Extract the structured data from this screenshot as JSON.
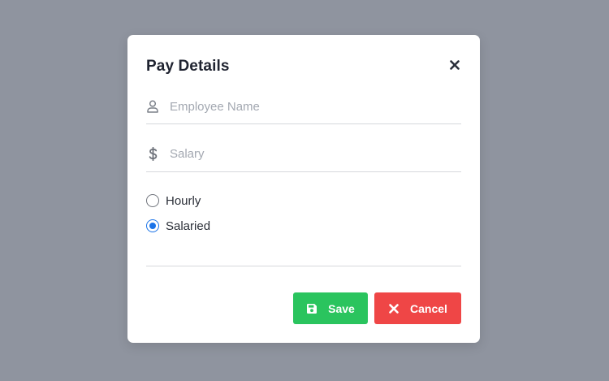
{
  "modal": {
    "title": "Pay Details",
    "close_icon": "close-icon"
  },
  "fields": {
    "employee_name": {
      "icon": "user-icon",
      "placeholder": "Employee Name",
      "value": ""
    },
    "salary": {
      "icon": "dollar-icon",
      "placeholder": "Salary",
      "value": ""
    }
  },
  "pay_type": {
    "options": [
      {
        "label": "Hourly",
        "checked": false
      },
      {
        "label": "Salaried",
        "checked": true
      }
    ]
  },
  "buttons": {
    "save_label": "Save",
    "save_icon": "floppy-disk-icon",
    "cancel_label": "Cancel",
    "cancel_icon": "x-icon"
  },
  "colors": {
    "backdrop": "#8f949f",
    "save": "#2ac45e",
    "cancel": "#ef4646",
    "radio_accent": "#1a73e8"
  }
}
